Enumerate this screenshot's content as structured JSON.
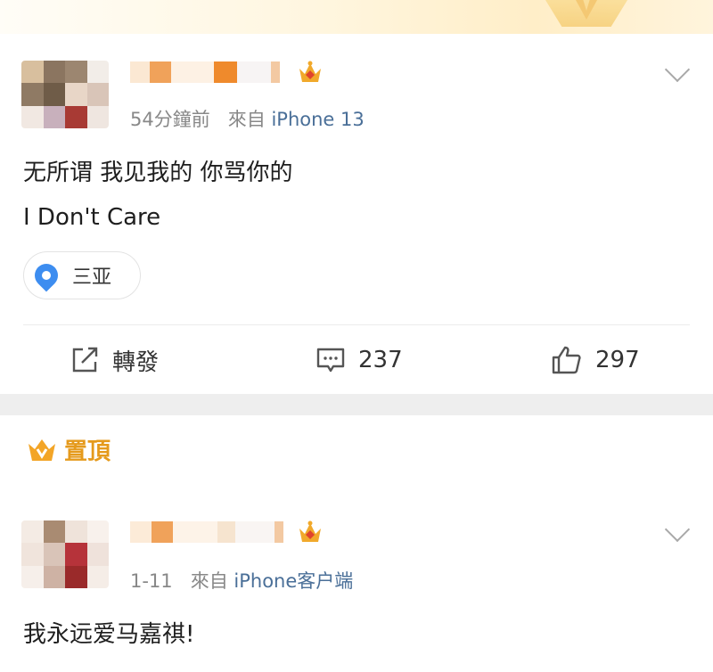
{
  "posts": [
    {
      "time": "54分鐘前",
      "source_prefix": "來自",
      "source": "iPhone 13",
      "text_lines": [
        "无所谓 我见我的 你骂你的",
        "I Don't Care"
      ],
      "location": "三亚",
      "actions": {
        "repost": "轉發",
        "comments": "237",
        "likes": "297"
      }
    },
    {
      "pinned_label": "置頂",
      "time": "1-11",
      "source_prefix": "來自",
      "source": "iPhone客户端",
      "text_lines": [
        "我永远爱马嘉祺!"
      ]
    }
  ],
  "colors": {
    "accent_gold": "#e59a1c",
    "source_link": "#4a6f98",
    "location_pin": "#3d8df0"
  },
  "icons": [
    "crown-icon",
    "chevron-down-icon",
    "location-pin-icon",
    "repost-icon",
    "comment-icon",
    "like-icon",
    "pinned-crown-icon"
  ]
}
